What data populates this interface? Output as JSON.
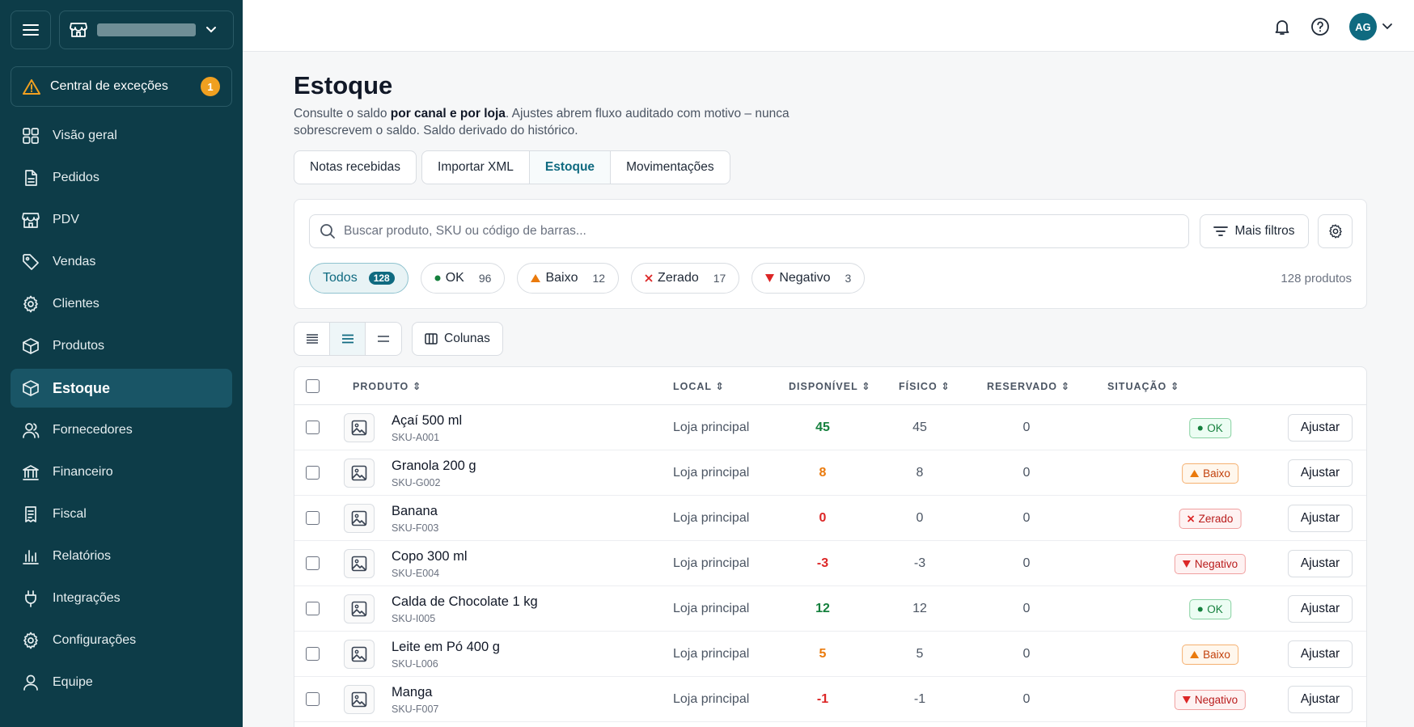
{
  "sidebar": {
    "exceptions_label": "Central de exceções",
    "exceptions_count": "1",
    "items": [
      {
        "label": "Visão geral",
        "icon": "grid-icon"
      },
      {
        "label": "Pedidos",
        "icon": "document-icon"
      },
      {
        "label": "PDV",
        "icon": "store-icon"
      },
      {
        "label": "Vendas",
        "icon": "tag-icon"
      },
      {
        "label": "Clientes",
        "icon": "gear-icon"
      },
      {
        "label": "Produtos",
        "icon": "box-icon"
      },
      {
        "label": "Estoque",
        "icon": "box-icon",
        "active": true
      },
      {
        "label": "Fornecedores",
        "icon": "users-icon"
      },
      {
        "label": "Financeiro",
        "icon": "bank-icon"
      },
      {
        "label": "Fiscal",
        "icon": "receipt-icon"
      },
      {
        "label": "Relatórios",
        "icon": "bar-chart-icon"
      },
      {
        "label": "Integrações",
        "icon": "plug-icon"
      },
      {
        "label": "Configurações",
        "icon": "gear-icon"
      },
      {
        "label": "Equipe",
        "icon": "user-icon"
      }
    ]
  },
  "topbar": {
    "avatar_initials": "AG"
  },
  "page": {
    "title": "Estoque",
    "desc_1": "Consulte o saldo ",
    "desc_bold": "por canal e por loja",
    "desc_2": ". Ajustes abrem fluxo auditado com motivo – nunca sobrescrevem o saldo. Saldo derivado do histórico."
  },
  "tabs": [
    "Notas recebidas",
    "Importar XML",
    "Estoque",
    "Movimentações"
  ],
  "search": {
    "placeholder": "Buscar produto, SKU ou código de barras...",
    "more_filters": "Mais filtros"
  },
  "chips": [
    {
      "label": "Todos",
      "count": "128"
    },
    {
      "label": "OK",
      "count": "96"
    },
    {
      "label": "Baixo",
      "count": "12"
    },
    {
      "label": "Zerado",
      "count": "17"
    },
    {
      "label": "Negativo",
      "count": "3"
    }
  ],
  "product_count": "128 produtos",
  "columns_button": "Colunas",
  "table": {
    "headers": {
      "produto": "PRODUTO",
      "local": "LOCAL",
      "disponivel": "DISPONÍVEL",
      "fisico": "FÍSICO",
      "reservado": "RESERVADO",
      "situacao": "SITUAÇÃO"
    },
    "adjust_label": "Ajustar",
    "rows": [
      {
        "name": "Açaí 500 ml",
        "sku": "SKU-A001",
        "local": "Loja principal",
        "disp": "45",
        "fis": "45",
        "res": "0",
        "status": "OK"
      },
      {
        "name": "Granola 200 g",
        "sku": "SKU-G002",
        "local": "Loja principal",
        "disp": "8",
        "fis": "8",
        "res": "0",
        "status": "Baixo"
      },
      {
        "name": "Banana",
        "sku": "SKU-F003",
        "local": "Loja principal",
        "disp": "0",
        "fis": "0",
        "res": "0",
        "status": "Zerado"
      },
      {
        "name": "Copo 300 ml",
        "sku": "SKU-E004",
        "local": "Loja principal",
        "disp": "-3",
        "fis": "-3",
        "res": "0",
        "status": "Negativo"
      },
      {
        "name": "Calda de Chocolate 1 kg",
        "sku": "SKU-I005",
        "local": "Loja principal",
        "disp": "12",
        "fis": "12",
        "res": "0",
        "status": "OK"
      },
      {
        "name": "Leite em Pó 400 g",
        "sku": "SKU-L006",
        "local": "Loja principal",
        "disp": "5",
        "fis": "5",
        "res": "0",
        "status": "Baixo"
      },
      {
        "name": "Manga",
        "sku": "SKU-F007",
        "local": "Loja principal",
        "disp": "-1",
        "fis": "-1",
        "res": "0",
        "status": "Negativo"
      }
    ]
  },
  "colors": {
    "sidebar": "#0d3c48",
    "accent": "#0f6a80",
    "ok": "#15803d",
    "low": "#ea7a0c",
    "danger": "#dc2626"
  }
}
